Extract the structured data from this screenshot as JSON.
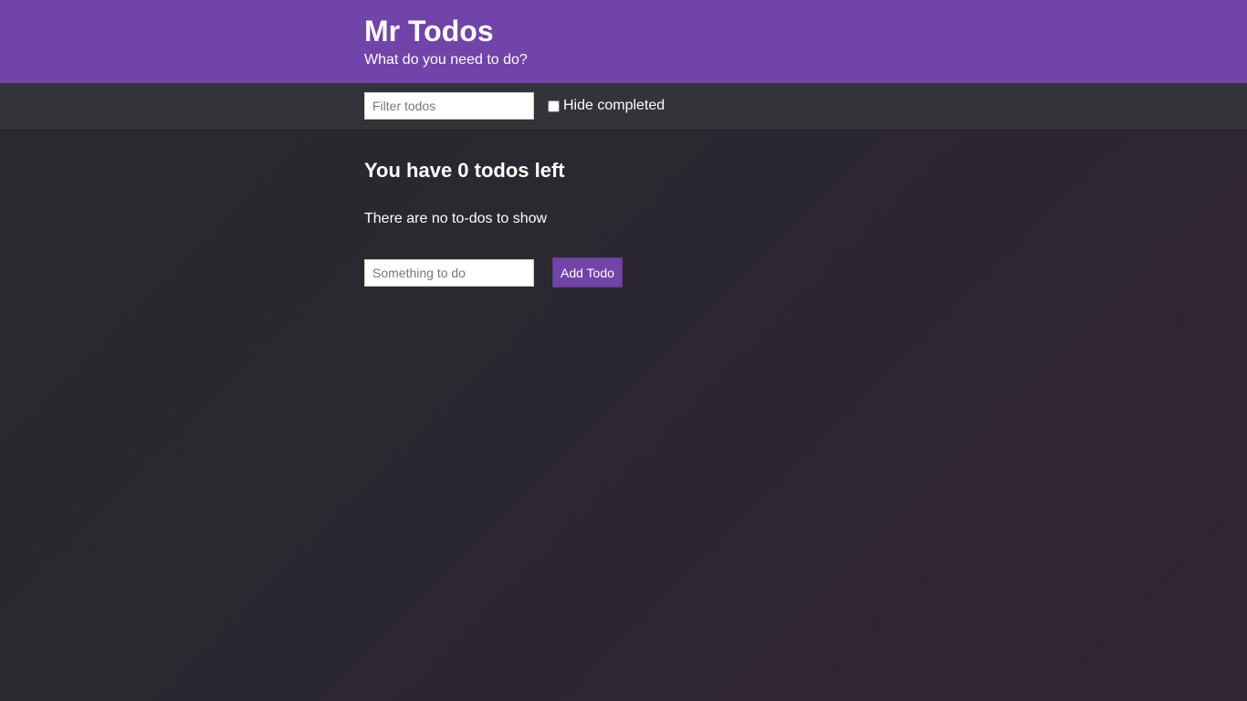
{
  "header": {
    "title": "Mr Todos",
    "subtitle": "What do you need to do?"
  },
  "filter": {
    "placeholder": "Filter todos",
    "value": "",
    "hide_completed_label": "Hide completed",
    "hide_completed_checked": false
  },
  "main": {
    "heading": "You have 0 todos left",
    "empty_message": "There are no to-dos to show",
    "new_todo_placeholder": "Something to do",
    "new_todo_value": "",
    "add_button_label": "Add Todo"
  },
  "colors": {
    "accent": "#7044a8",
    "filterbar": "#333437",
    "background": "#2b2830"
  }
}
